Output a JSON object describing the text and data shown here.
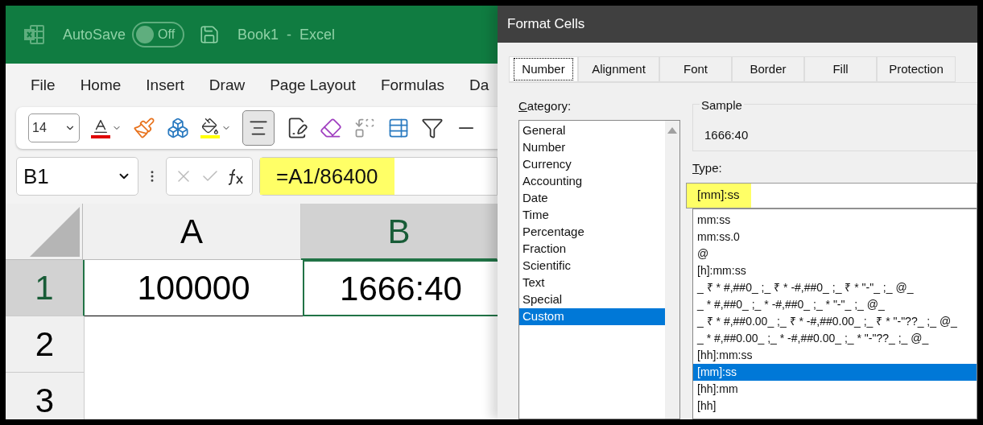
{
  "excel": {
    "title_bar": {
      "autosave_label": "AutoSave",
      "autosave_toggle": {
        "label": "Off",
        "on": false
      },
      "title": "Book1  -  Excel"
    },
    "menu": [
      {
        "label": "File"
      },
      {
        "label": "Home"
      },
      {
        "label": "Insert"
      },
      {
        "label": "Draw"
      },
      {
        "label": "Page Layout"
      },
      {
        "label": "Formulas"
      },
      {
        "label": "Da"
      }
    ],
    "toolbar": {
      "font_size": "14",
      "align_center_selected": true
    },
    "name_box": "B1",
    "formula": {
      "text": "=A1/86400",
      "highlighted": true
    },
    "columns": [
      {
        "label": "A",
        "selected": false
      },
      {
        "label": "B",
        "selected": true
      }
    ],
    "rows": [
      {
        "label": "1",
        "selected": true,
        "cells": [
          {
            "value": "100000",
            "selected": false
          },
          {
            "value": "1666:40",
            "selected": true
          }
        ]
      },
      {
        "label": "2",
        "selected": false
      },
      {
        "label": "3",
        "selected": false
      }
    ]
  },
  "dialog": {
    "title": "Format Cells",
    "tabs": [
      {
        "label": "Number",
        "selected": true
      },
      {
        "label": "Alignment",
        "selected": false
      },
      {
        "label": "Font",
        "selected": false
      },
      {
        "label": "Border",
        "selected": false
      },
      {
        "label": "Fill",
        "selected": false
      },
      {
        "label": "Protection",
        "selected": false
      }
    ],
    "category_label": "Category:",
    "categories": [
      {
        "label": "General",
        "selected": false
      },
      {
        "label": "Number",
        "selected": false
      },
      {
        "label": "Currency",
        "selected": false
      },
      {
        "label": "Accounting",
        "selected": false
      },
      {
        "label": "Date",
        "selected": false
      },
      {
        "label": "Time",
        "selected": false
      },
      {
        "label": "Percentage",
        "selected": false
      },
      {
        "label": "Fraction",
        "selected": false
      },
      {
        "label": "Scientific",
        "selected": false
      },
      {
        "label": "Text",
        "selected": false
      },
      {
        "label": "Special",
        "selected": false
      },
      {
        "label": "Custom",
        "selected": true
      }
    ],
    "sample_label": "Sample",
    "sample": "1666:40",
    "type_label": "Type:",
    "type_field": {
      "value": "[mm]:ss",
      "highlighted": true
    },
    "types": [
      {
        "label": "mm:ss",
        "selected": false
      },
      {
        "label": "mm:ss.0",
        "selected": false
      },
      {
        "label": "@",
        "selected": false
      },
      {
        "label": "[h]:mm:ss",
        "selected": false
      },
      {
        "label": "_ ₹ * #,##0_ ;_ ₹ * -#,##0_ ;_ ₹ * \"-\"_ ;_ @_",
        "selected": false
      },
      {
        "label": "_ * #,##0_ ;_ * -#,##0_ ;_ * \"-\"_ ;_ @_",
        "selected": false
      },
      {
        "label": "_ ₹ * #,##0.00_ ;_ ₹ * -#,##0.00_ ;_ ₹ * \"-\"??_ ;_ @_",
        "selected": false
      },
      {
        "label": "_ * #,##0.00_ ;_ * -#,##0.00_ ;_ * \"-\"??_ ;_ @_",
        "selected": false
      },
      {
        "label": "[hh]:mm:ss",
        "selected": false
      },
      {
        "label": "[mm]:ss",
        "selected": true
      },
      {
        "label": "[hh]:mm",
        "selected": false
      },
      {
        "label": "[hh]",
        "selected": false
      }
    ]
  }
}
